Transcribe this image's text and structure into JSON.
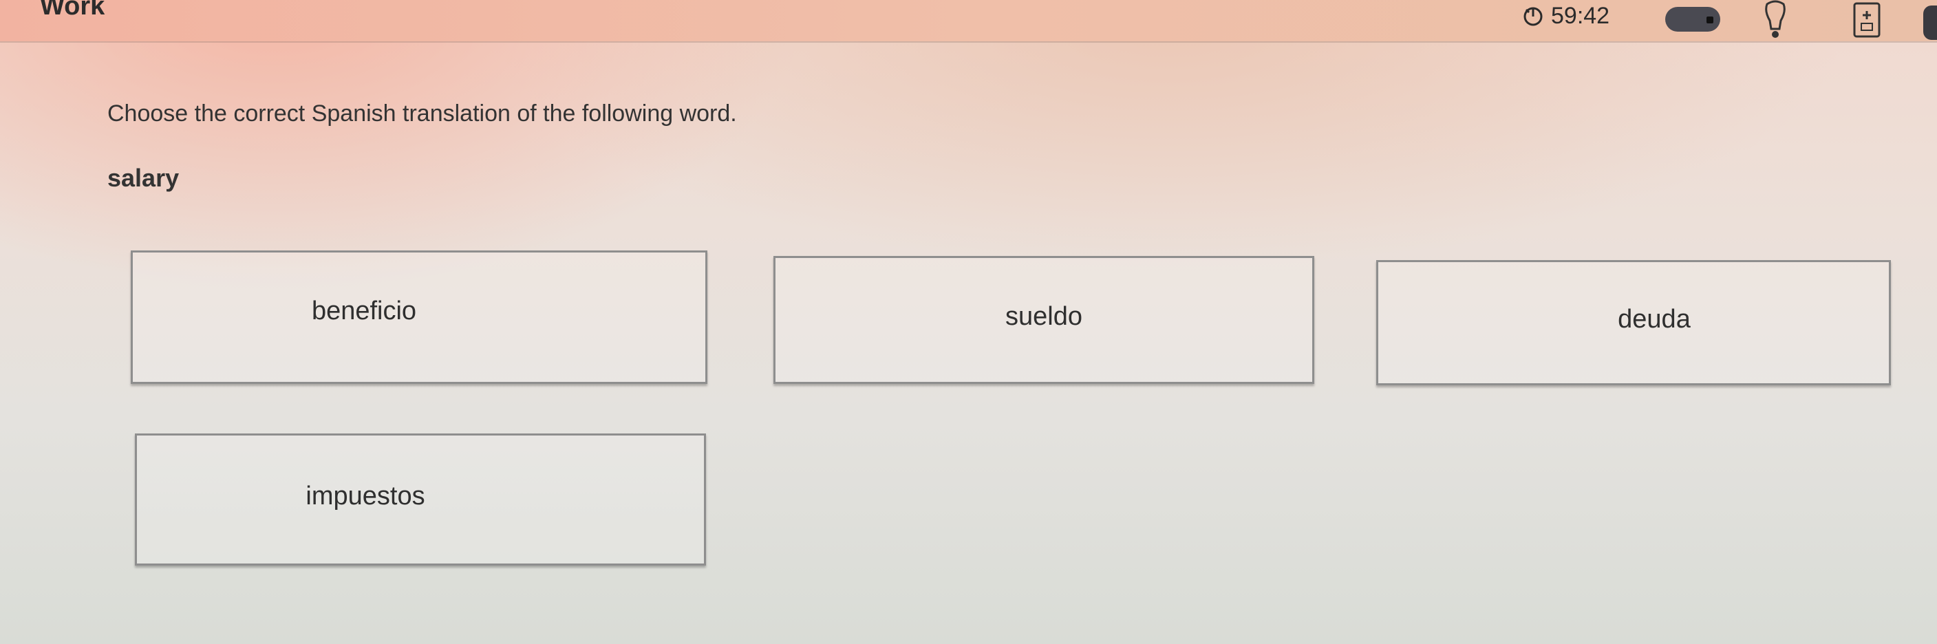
{
  "header": {
    "title": "Work",
    "timer": "59:42",
    "icons": [
      "timer-icon",
      "toggle-switch",
      "hint-lightbulb-icon",
      "calculator-icon"
    ]
  },
  "question": {
    "prompt": "Choose the correct Spanish translation of the following word.",
    "word": "salary"
  },
  "options": [
    {
      "label": "beneficio"
    },
    {
      "label": "sueldo"
    },
    {
      "label": "deuda"
    },
    {
      "label": "impuestos"
    }
  ]
}
